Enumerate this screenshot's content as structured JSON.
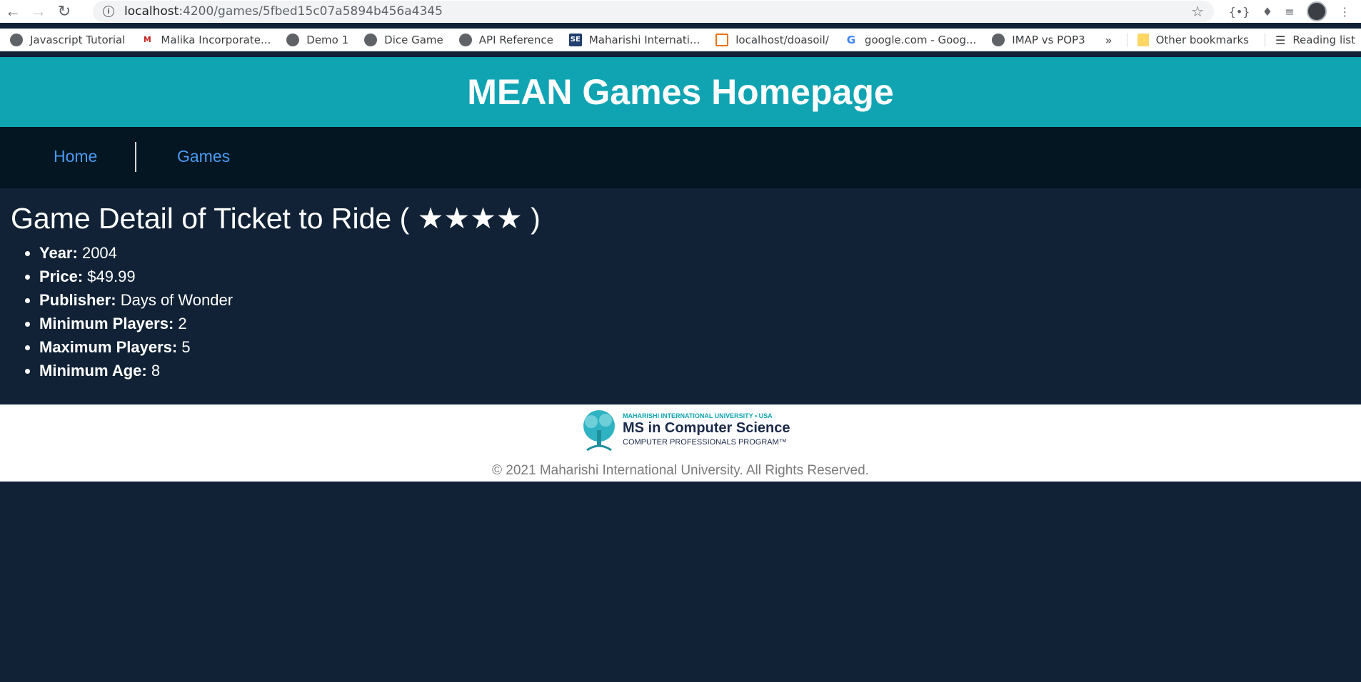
{
  "browser": {
    "url_host": "localhost",
    "url_rest": ":4200/games/5fbed15c07a5894b456a4345",
    "bookmarks": [
      {
        "label": "Javascript Tutorial",
        "icon": "globe-icon"
      },
      {
        "label": "Malika Incorporate...",
        "icon": "m-icon"
      },
      {
        "label": "Demo 1",
        "icon": "globe-icon"
      },
      {
        "label": "Dice Game",
        "icon": "globe-icon"
      },
      {
        "label": "API Reference",
        "icon": "globe-icon"
      },
      {
        "label": "Maharishi Internati...",
        "icon": "se-icon"
      },
      {
        "label": "localhost/doasoil/",
        "icon": "xampp-icon"
      },
      {
        "label": "google.com - Goog...",
        "icon": "google-icon"
      },
      {
        "label": "IMAP vs POP3",
        "icon": "globe-icon"
      }
    ],
    "overflow": "»",
    "other_bookmarks": "Other bookmarks",
    "reading_list": "Reading list"
  },
  "header": {
    "title": "MEAN Games Homepage"
  },
  "nav": {
    "home": "Home",
    "games": "Games"
  },
  "game": {
    "title": "Game Detail of Ticket to Ride ( ★★★★ )",
    "rating": 4,
    "fields": [
      {
        "label": "Year:",
        "value": "2004"
      },
      {
        "label": "Price:",
        "value": "$49.99"
      },
      {
        "label": "Publisher:",
        "value": "Days of Wonder"
      },
      {
        "label": "Minimum Players:",
        "value": "2"
      },
      {
        "label": "Maximum Players:",
        "value": "5"
      },
      {
        "label": "Minimum Age:",
        "value": "8"
      }
    ]
  },
  "footer": {
    "logo_top": "MAHARISHI INTERNATIONAL UNIVERSITY • USA",
    "logo_main": "MS in Computer Science",
    "logo_sub": "COMPUTER PROFESSIONALS PROGRAM™",
    "copyright": "© 2021 Maharishi International University. All Rights Reserved."
  },
  "colors": {
    "header_bg": "#10a4b3",
    "nav_bg": "#031621",
    "body_bg": "#112236",
    "link": "#4b9bf5"
  }
}
